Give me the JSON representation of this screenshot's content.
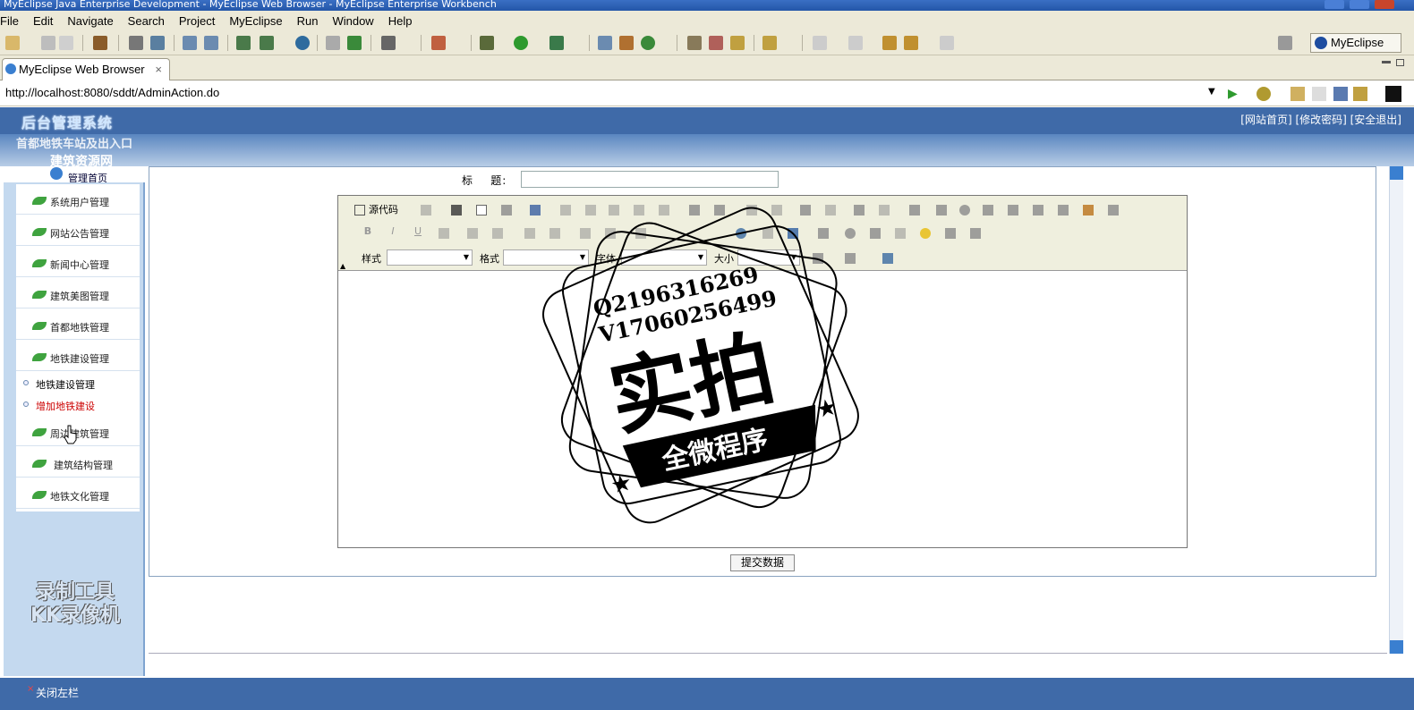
{
  "window": {
    "title": "MyEclipse Java Enterprise Development - MyEclipse Web Browser - MyEclipse Enterprise Workbench"
  },
  "menu": [
    "File",
    "Edit",
    "Navigate",
    "Search",
    "Project",
    "MyEclipse",
    "Run",
    "Window",
    "Help"
  ],
  "perspective": {
    "label": "MyEclipse J..."
  },
  "editor_tab": {
    "label": "MyEclipse Web Browser",
    "close": "×"
  },
  "browser": {
    "url": "http://localhost:8080/sddt/AdminAction.do"
  },
  "app": {
    "system_title": "后台管理系统",
    "subtitle_line1": "首都地铁车站及出入口",
    "subtitle_line2": "建筑资源网",
    "home_link": "管理首页",
    "top_links": "[网站首页] [修改密码] [安全退出]"
  },
  "sidebar": {
    "items": [
      {
        "label": "系统用户管理"
      },
      {
        "label": "网站公告管理"
      },
      {
        "label": "新闻中心管理"
      },
      {
        "label": "建筑美图管理"
      },
      {
        "label": "首都地铁管理"
      },
      {
        "label": "地铁建设管理"
      },
      {
        "label": "周边建筑管理"
      },
      {
        "label": "建筑结构管理"
      },
      {
        "label": "地铁文化管理"
      }
    ],
    "subitems": [
      {
        "label": "地铁建设管理",
        "color": "#000000"
      },
      {
        "label": "增加地铁建设",
        "color": "#cc0000"
      }
    ],
    "watermark_line1": "录制工具",
    "watermark_line2": "KK录像机"
  },
  "form": {
    "title_label": "标    题:",
    "title_value": "",
    "source_button": "源代码",
    "style_label": "样式",
    "format_label": "格式",
    "font_label": "字体",
    "size_label": "大小",
    "submit": "提交数据"
  },
  "stamp": {
    "line1": "Q2196316269",
    "line2": "V17060256499",
    "main": "实拍",
    "banner": "全微程序"
  },
  "footer": {
    "close_sidebar": "关闭左栏",
    "close_icon": "×"
  },
  "colors": {
    "header_blue": "#3f6aa8",
    "sidebar_bg": "#c4d9ef",
    "chrome_bg": "#ece9d8"
  }
}
